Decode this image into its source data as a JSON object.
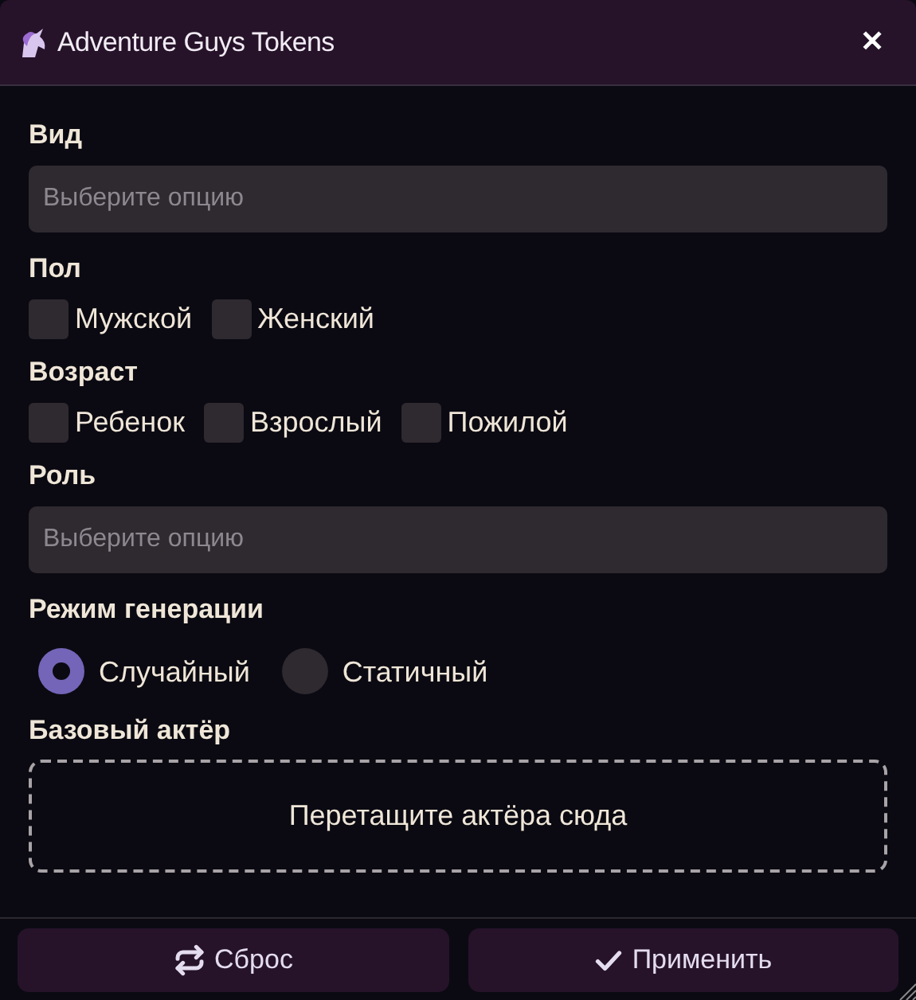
{
  "window": {
    "title": "Adventure Guys Tokens",
    "close": "✕"
  },
  "sections": [
    {
      "kind": "select",
      "label": "Вид",
      "placeholder": "Выберите опцию"
    },
    {
      "kind": "checkboxes",
      "label": "Пол",
      "options": [
        {
          "label": "Мужской",
          "checked": false
        },
        {
          "label": "Женский",
          "checked": false
        }
      ]
    },
    {
      "kind": "checkboxes",
      "label": "Возраст",
      "options": [
        {
          "label": "Ребенок",
          "checked": false
        },
        {
          "label": "Взрослый",
          "checked": false
        },
        {
          "label": "Пожилой",
          "checked": false
        }
      ]
    },
    {
      "kind": "select",
      "label": "Роль",
      "placeholder": "Выберите опцию"
    },
    {
      "kind": "radios",
      "label": "Режим генерации",
      "options": [
        {
          "label": "Случайный",
          "selected": true
        },
        {
          "label": "Статичный",
          "selected": false
        }
      ]
    },
    {
      "kind": "dropzone",
      "label": "Базовый актёр",
      "text": "Перетащите актёра сюда"
    }
  ],
  "buttons": [
    {
      "kind": "reset",
      "label": "Сброс"
    },
    {
      "kind": "apply",
      "label": "Применить"
    }
  ]
}
